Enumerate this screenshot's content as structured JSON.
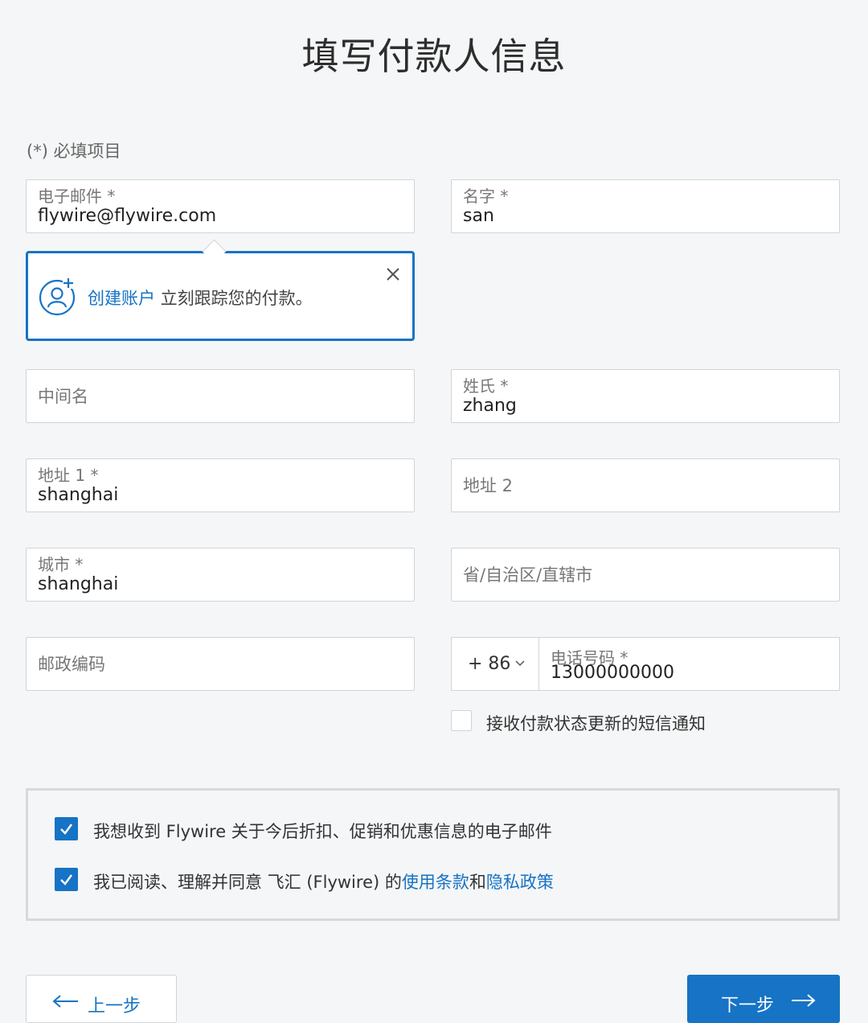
{
  "page_title": "填写付款人信息",
  "required_note": "(*) 必填项目",
  "fields": {
    "email": {
      "label": "电子邮件 *",
      "value": "flywire@flywire.com"
    },
    "first_name": {
      "label": "名字 *",
      "value": "san"
    },
    "middle_name": {
      "placeholder": "中间名"
    },
    "last_name": {
      "label": "姓氏 *",
      "value": "zhang"
    },
    "address1": {
      "label": "地址 1 *",
      "value": "shanghai"
    },
    "address2": {
      "placeholder": "地址 2"
    },
    "city": {
      "label": "城市 *",
      "value": "shanghai"
    },
    "province": {
      "placeholder": "省/自治区/直辖市"
    },
    "postal": {
      "placeholder": "邮政编码"
    },
    "country_code": "+ 86",
    "phone": {
      "label": "电话号码 *",
      "value": "13000000000"
    }
  },
  "popover": {
    "link": "创建账户",
    "text": " 立刻跟踪您的付款。"
  },
  "sms_opt_in": {
    "label": "接收付款状态更新的短信通知",
    "checked": false
  },
  "consent": {
    "marketing": {
      "text": "我想收到 Flywire 关于今后折扣、促销和优惠信息的电子邮件",
      "checked": true
    },
    "terms": {
      "prefix": "我已阅读、理解并同意 飞汇 (Flywire) 的",
      "terms_link": "使用条款",
      "and": "和",
      "privacy_link": "隐私政策",
      "checked": true
    }
  },
  "buttons": {
    "back": "上一步",
    "next": "下一步"
  },
  "colors": {
    "accent": "#1673c5",
    "background": "#f5f6f7",
    "border": "#cfd5da"
  }
}
